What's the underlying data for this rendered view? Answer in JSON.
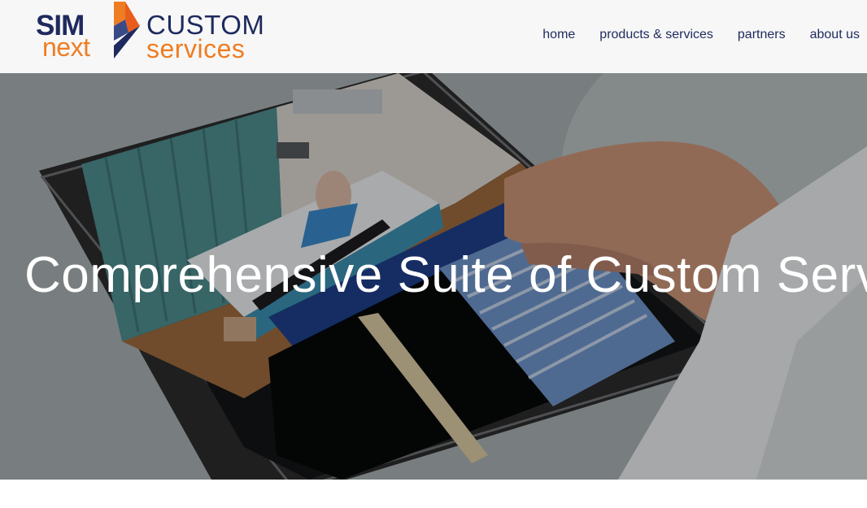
{
  "logo": {
    "sim": "SIM",
    "next": "next",
    "custom": "CUSTOM",
    "services": "services",
    "colors": {
      "navy": "#1e2a5e",
      "orange": "#ef7d22"
    }
  },
  "nav": {
    "items": [
      {
        "label": "home"
      },
      {
        "label": "products & services"
      },
      {
        "label": "partners"
      },
      {
        "label": "about us"
      }
    ]
  },
  "hero": {
    "title": "Comprehensive Suite of Custom Services",
    "image_icon": "tablet-medical-simulation-image"
  }
}
